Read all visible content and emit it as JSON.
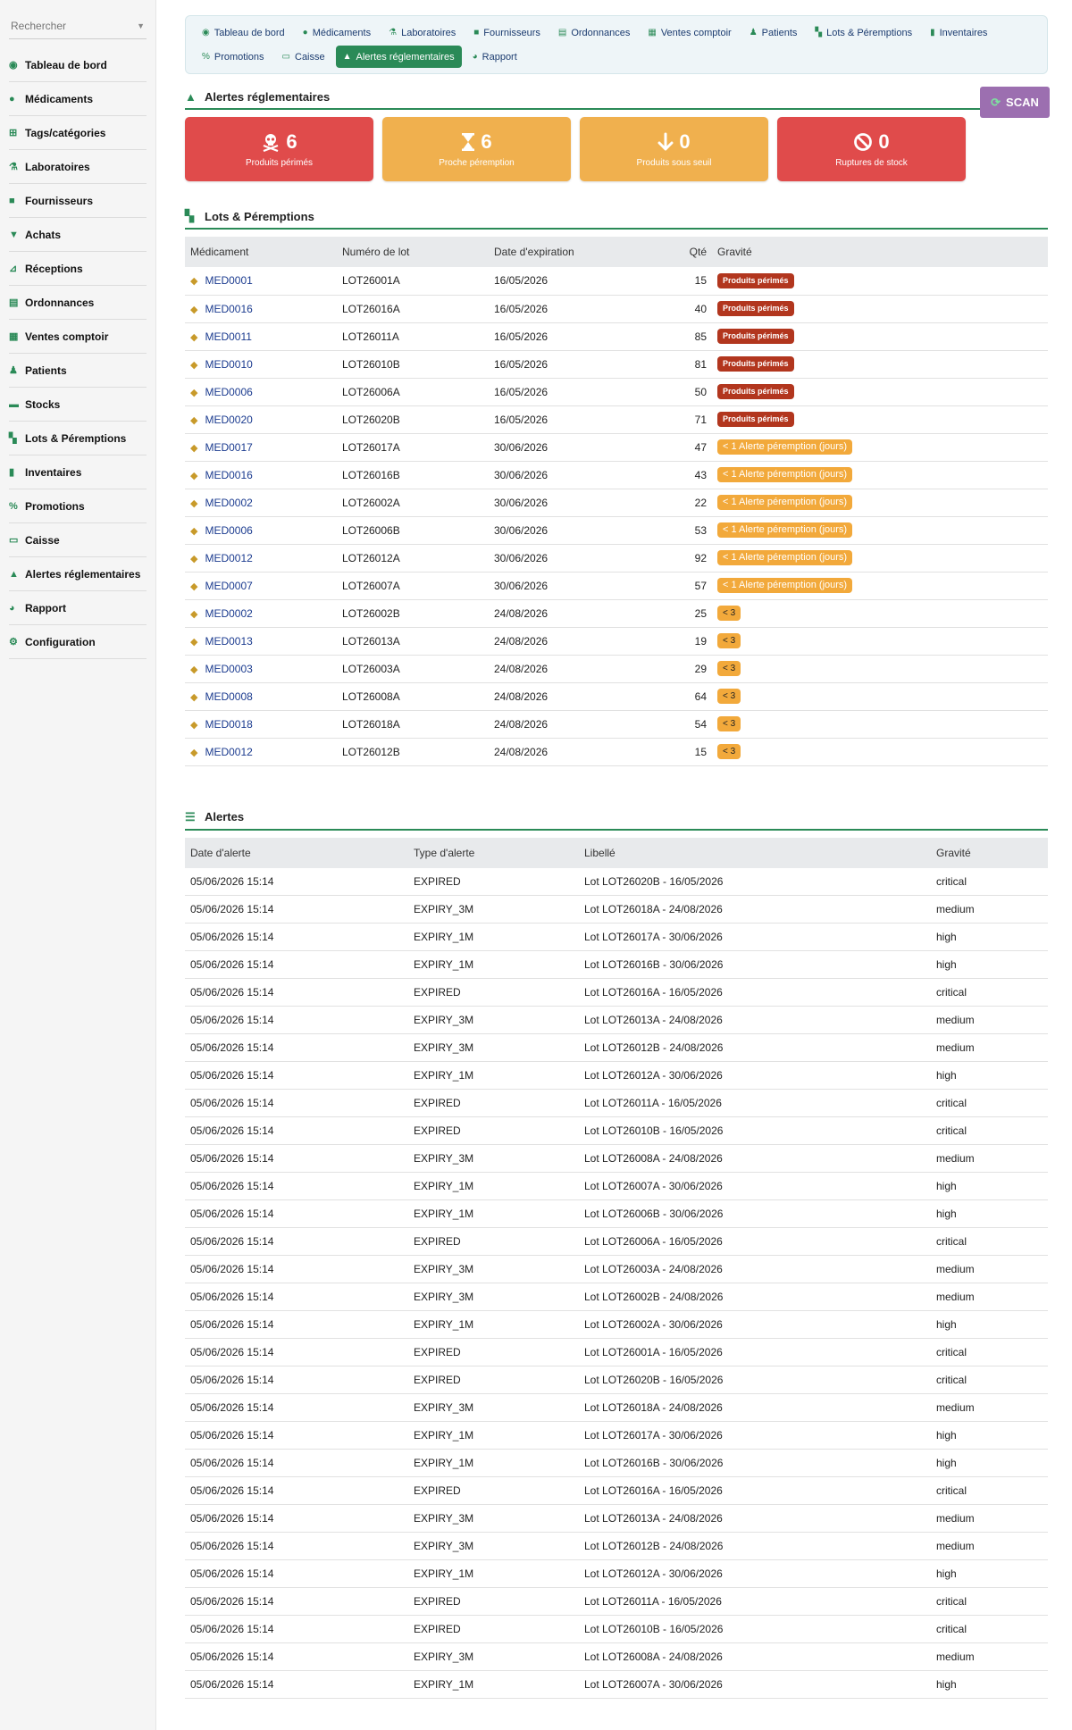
{
  "sidebar": {
    "search_placeholder": "Rechercher",
    "items": [
      {
        "label": "Tableau de bord",
        "icon": "dashboard-icon"
      },
      {
        "label": "Médicaments",
        "icon": "pills-icon"
      },
      {
        "label": "Tags/catégories",
        "icon": "sitemap-icon"
      },
      {
        "label": "Laboratoires",
        "icon": "flask-icon"
      },
      {
        "label": "Fournisseurs",
        "icon": "truck-icon"
      },
      {
        "label": "Achats",
        "icon": "cart-icon"
      },
      {
        "label": "Réceptions",
        "icon": "dolly-icon"
      },
      {
        "label": "Ordonnances",
        "icon": "prescription-icon"
      },
      {
        "label": "Ventes comptoir",
        "icon": "cash-register-icon"
      },
      {
        "label": "Patients",
        "icon": "user-icon"
      },
      {
        "label": "Stocks",
        "icon": "warehouse-icon"
      },
      {
        "label": "Lots & Péremptions",
        "icon": "boxes-icon"
      },
      {
        "label": "Inventaires",
        "icon": "clipboard-icon"
      },
      {
        "label": "Promotions",
        "icon": "percent-icon"
      },
      {
        "label": "Caisse",
        "icon": "money-icon"
      },
      {
        "label": "Alertes réglementaires",
        "icon": "warning-icon"
      },
      {
        "label": "Rapport",
        "icon": "chart-pie-icon"
      },
      {
        "label": "Configuration",
        "icon": "gear-icon"
      }
    ]
  },
  "nav": {
    "tabs": [
      {
        "label": "Tableau de bord",
        "active": false
      },
      {
        "label": "Médicaments",
        "active": false
      },
      {
        "label": "Laboratoires",
        "active": false
      },
      {
        "label": "Fournisseurs",
        "active": false
      },
      {
        "label": "Ordonnances",
        "active": false
      },
      {
        "label": "Ventes comptoir",
        "active": false
      },
      {
        "label": "Patients",
        "active": false
      },
      {
        "label": "Lots & Péremptions",
        "active": false
      },
      {
        "label": "Inventaires",
        "active": false
      },
      {
        "label": "Promotions",
        "active": false
      },
      {
        "label": "Caisse",
        "active": false
      },
      {
        "label": "Alertes réglementaires",
        "active": true
      },
      {
        "label": "Rapport",
        "active": false
      }
    ]
  },
  "alerts_header": {
    "title": "Alertes réglementaires",
    "scan_label": "SCAN"
  },
  "cards": [
    {
      "value": "6",
      "label": "Produits périmés",
      "icon": "skull-icon",
      "color": "#e04b4b"
    },
    {
      "value": "6",
      "label": "Proche péremption",
      "icon": "hourglass-icon",
      "color": "#f0b04e"
    },
    {
      "value": "0",
      "label": "Produits sous seuil",
      "icon": "arrow-down-icon",
      "color": "#f0b04e"
    },
    {
      "value": "0",
      "label": "Ruptures de stock",
      "icon": "ban-icon",
      "color": "#e04b4b"
    }
  ],
  "lots": {
    "title": "Lots & Péremptions",
    "columns": [
      "Médicament",
      "Numéro de lot",
      "Date d'expiration",
      "Qté",
      "Gravité"
    ],
    "rows": [
      {
        "med": "MED0001",
        "lot": "LOT26001A",
        "date": "16/05/2026",
        "qty": "15",
        "gravity": "Produits périmés",
        "level": "red"
      },
      {
        "med": "MED0016",
        "lot": "LOT26016A",
        "date": "16/05/2026",
        "qty": "40",
        "gravity": "Produits périmés",
        "level": "red"
      },
      {
        "med": "MED0011",
        "lot": "LOT26011A",
        "date": "16/05/2026",
        "qty": "85",
        "gravity": "Produits périmés",
        "level": "red"
      },
      {
        "med": "MED0010",
        "lot": "LOT26010B",
        "date": "16/05/2026",
        "qty": "81",
        "gravity": "Produits périmés",
        "level": "red"
      },
      {
        "med": "MED0006",
        "lot": "LOT26006A",
        "date": "16/05/2026",
        "qty": "50",
        "gravity": "Produits périmés",
        "level": "red"
      },
      {
        "med": "MED0020",
        "lot": "LOT26020B",
        "date": "16/05/2026",
        "qty": "71",
        "gravity": "Produits périmés",
        "level": "red"
      },
      {
        "med": "MED0017",
        "lot": "LOT26017A",
        "date": "30/06/2026",
        "qty": "47",
        "gravity": "< 1 Alerte péremption (jours)",
        "level": "orange"
      },
      {
        "med": "MED0016",
        "lot": "LOT26016B",
        "date": "30/06/2026",
        "qty": "43",
        "gravity": "< 1 Alerte péremption (jours)",
        "level": "orange"
      },
      {
        "med": "MED0002",
        "lot": "LOT26002A",
        "date": "30/06/2026",
        "qty": "22",
        "gravity": "< 1 Alerte péremption (jours)",
        "level": "orange"
      },
      {
        "med": "MED0006",
        "lot": "LOT26006B",
        "date": "30/06/2026",
        "qty": "53",
        "gravity": "< 1 Alerte péremption (jours)",
        "level": "orange"
      },
      {
        "med": "MED0012",
        "lot": "LOT26012A",
        "date": "30/06/2026",
        "qty": "92",
        "gravity": "< 1 Alerte péremption (jours)",
        "level": "orange"
      },
      {
        "med": "MED0007",
        "lot": "LOT26007A",
        "date": "30/06/2026",
        "qty": "57",
        "gravity": "< 1 Alerte péremption (jours)",
        "level": "orange"
      },
      {
        "med": "MED0002",
        "lot": "LOT26002B",
        "date": "24/08/2026",
        "qty": "25",
        "gravity": "< 3",
        "level": "small"
      },
      {
        "med": "MED0013",
        "lot": "LOT26013A",
        "date": "24/08/2026",
        "qty": "19",
        "gravity": "< 3",
        "level": "small"
      },
      {
        "med": "MED0003",
        "lot": "LOT26003A",
        "date": "24/08/2026",
        "qty": "29",
        "gravity": "< 3",
        "level": "small"
      },
      {
        "med": "MED0008",
        "lot": "LOT26008A",
        "date": "24/08/2026",
        "qty": "64",
        "gravity": "< 3",
        "level": "small"
      },
      {
        "med": "MED0018",
        "lot": "LOT26018A",
        "date": "24/08/2026",
        "qty": "54",
        "gravity": "< 3",
        "level": "small"
      },
      {
        "med": "MED0012",
        "lot": "LOT26012B",
        "date": "24/08/2026",
        "qty": "15",
        "gravity": "< 3",
        "level": "small"
      }
    ]
  },
  "alerts": {
    "title": "Alertes",
    "columns": [
      "Date d'alerte",
      "Type d'alerte",
      "Libellé",
      "Gravité"
    ],
    "rows": [
      {
        "date": "05/06/2026 15:14",
        "type": "EXPIRED",
        "label": "Lot LOT26020B - 16/05/2026",
        "gravity": "critical"
      },
      {
        "date": "05/06/2026 15:14",
        "type": "EXPIRY_3M",
        "label": "Lot LOT26018A - 24/08/2026",
        "gravity": "medium"
      },
      {
        "date": "05/06/2026 15:14",
        "type": "EXPIRY_1M",
        "label": "Lot LOT26017A - 30/06/2026",
        "gravity": "high"
      },
      {
        "date": "05/06/2026 15:14",
        "type": "EXPIRY_1M",
        "label": "Lot LOT26016B - 30/06/2026",
        "gravity": "high"
      },
      {
        "date": "05/06/2026 15:14",
        "type": "EXPIRED",
        "label": "Lot LOT26016A - 16/05/2026",
        "gravity": "critical"
      },
      {
        "date": "05/06/2026 15:14",
        "type": "EXPIRY_3M",
        "label": "Lot LOT26013A - 24/08/2026",
        "gravity": "medium"
      },
      {
        "date": "05/06/2026 15:14",
        "type": "EXPIRY_3M",
        "label": "Lot LOT26012B - 24/08/2026",
        "gravity": "medium"
      },
      {
        "date": "05/06/2026 15:14",
        "type": "EXPIRY_1M",
        "label": "Lot LOT26012A - 30/06/2026",
        "gravity": "high"
      },
      {
        "date": "05/06/2026 15:14",
        "type": "EXPIRED",
        "label": "Lot LOT26011A - 16/05/2026",
        "gravity": "critical"
      },
      {
        "date": "05/06/2026 15:14",
        "type": "EXPIRED",
        "label": "Lot LOT26010B - 16/05/2026",
        "gravity": "critical"
      },
      {
        "date": "05/06/2026 15:14",
        "type": "EXPIRY_3M",
        "label": "Lot LOT26008A - 24/08/2026",
        "gravity": "medium"
      },
      {
        "date": "05/06/2026 15:14",
        "type": "EXPIRY_1M",
        "label": "Lot LOT26007A - 30/06/2026",
        "gravity": "high"
      },
      {
        "date": "05/06/2026 15:14",
        "type": "EXPIRY_1M",
        "label": "Lot LOT26006B - 30/06/2026",
        "gravity": "high"
      },
      {
        "date": "05/06/2026 15:14",
        "type": "EXPIRED",
        "label": "Lot LOT26006A - 16/05/2026",
        "gravity": "critical"
      },
      {
        "date": "05/06/2026 15:14",
        "type": "EXPIRY_3M",
        "label": "Lot LOT26003A - 24/08/2026",
        "gravity": "medium"
      },
      {
        "date": "05/06/2026 15:14",
        "type": "EXPIRY_3M",
        "label": "Lot LOT26002B - 24/08/2026",
        "gravity": "medium"
      },
      {
        "date": "05/06/2026 15:14",
        "type": "EXPIRY_1M",
        "label": "Lot LOT26002A - 30/06/2026",
        "gravity": "high"
      },
      {
        "date": "05/06/2026 15:14",
        "type": "EXPIRED",
        "label": "Lot LOT26001A - 16/05/2026",
        "gravity": "critical"
      },
      {
        "date": "05/06/2026 15:14",
        "type": "EXPIRED",
        "label": "Lot LOT26020B - 16/05/2026",
        "gravity": "critical"
      },
      {
        "date": "05/06/2026 15:14",
        "type": "EXPIRY_3M",
        "label": "Lot LOT26018A - 24/08/2026",
        "gravity": "medium"
      },
      {
        "date": "05/06/2026 15:14",
        "type": "EXPIRY_1M",
        "label": "Lot LOT26017A - 30/06/2026",
        "gravity": "high"
      },
      {
        "date": "05/06/2026 15:14",
        "type": "EXPIRY_1M",
        "label": "Lot LOT26016B - 30/06/2026",
        "gravity": "high"
      },
      {
        "date": "05/06/2026 15:14",
        "type": "EXPIRED",
        "label": "Lot LOT26016A - 16/05/2026",
        "gravity": "critical"
      },
      {
        "date": "05/06/2026 15:14",
        "type": "EXPIRY_3M",
        "label": "Lot LOT26013A - 24/08/2026",
        "gravity": "medium"
      },
      {
        "date": "05/06/2026 15:14",
        "type": "EXPIRY_3M",
        "label": "Lot LOT26012B - 24/08/2026",
        "gravity": "medium"
      },
      {
        "date": "05/06/2026 15:14",
        "type": "EXPIRY_1M",
        "label": "Lot LOT26012A - 30/06/2026",
        "gravity": "high"
      },
      {
        "date": "05/06/2026 15:14",
        "type": "EXPIRED",
        "label": "Lot LOT26011A - 16/05/2026",
        "gravity": "critical"
      },
      {
        "date": "05/06/2026 15:14",
        "type": "EXPIRED",
        "label": "Lot LOT26010B - 16/05/2026",
        "gravity": "critical"
      },
      {
        "date": "05/06/2026 15:14",
        "type": "EXPIRY_3M",
        "label": "Lot LOT26008A - 24/08/2026",
        "gravity": "medium"
      },
      {
        "date": "05/06/2026 15:14",
        "type": "EXPIRY_1M",
        "label": "Lot LOT26007A - 30/06/2026",
        "gravity": "high"
      }
    ]
  }
}
